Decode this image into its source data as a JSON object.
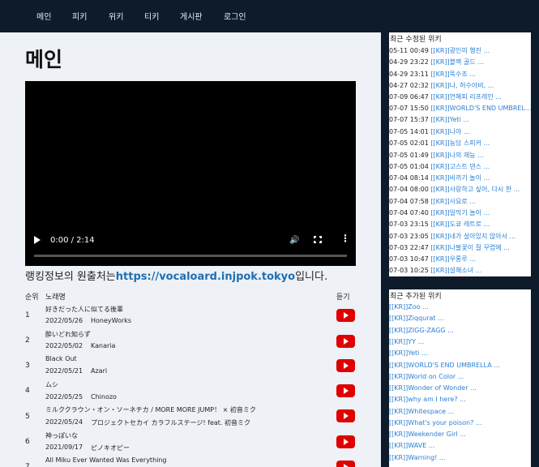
{
  "nav": [
    "메인",
    "피키",
    "위키",
    "티키",
    "게시판",
    "로그인"
  ],
  "main": {
    "title": "메인",
    "video": {
      "time": "0:00 / 2:14",
      "progress": 0
    },
    "source": {
      "prefix": "랭킹정보의 원출처는",
      "link": "https://vocaloard.injpok.tokyo",
      "suffix": "입니다."
    },
    "table": {
      "headers": {
        "rank": "순위",
        "song": "노래명",
        "listen": "듣기"
      },
      "rows": [
        {
          "rank": "1",
          "title": "好きだった人に似てる後輩",
          "date": "2022/05/26",
          "artist": "HoneyWorks"
        },
        {
          "rank": "2",
          "title": "酔いどれ知らず",
          "date": "2022/05/02",
          "artist": "Kanaria"
        },
        {
          "rank": "3",
          "title": "Black Out",
          "date": "2022/05/21",
          "artist": "Azari"
        },
        {
          "rank": "4",
          "title": "ムシ",
          "date": "2022/05/25",
          "artist": "Chinozo"
        },
        {
          "rank": "5",
          "title": "ミルククラウン・オン・ソーネチカ / MORE MORE JUMP！ × 初音ミク",
          "date": "2022/05/24",
          "artist": "プロジェクトセカイ カラフルステージ! feat. 初音ミク"
        },
        {
          "rank": "6",
          "title": "神っぽいな",
          "date": "2021/09/17",
          "artist": "ピノキオピー"
        },
        {
          "rank": "7",
          "title": "All Miku Ever Wanted Was Everything",
          "date": "",
          "artist": ""
        }
      ]
    }
  },
  "sidebar": {
    "recent_edits": {
      "title": "최근 수정된 위키",
      "items": [
        {
          "time": "05-11 00:49",
          "page": "[[KR]]광인의 행진 ..."
        },
        {
          "time": "04-29 23:22",
          "page": "[[KR]]블랙 골드 ..."
        },
        {
          "time": "04-29 23:11",
          "page": "[[KR]]뚝수조 ..."
        },
        {
          "time": "04-27 02:32",
          "page": "[[KR]]나, 허수아비, ..."
        },
        {
          "time": "07-09 06:47",
          "page": "[[KR]]언해피 리프레인 ..."
        },
        {
          "time": "07-07 15:50",
          "page": "[[KR]]WORLD'S END UMBREL..."
        },
        {
          "time": "07-07 15:37",
          "page": "[[KR]]Yeti ..."
        },
        {
          "time": "07-05 14:01",
          "page": "[[KR]]니아 ..."
        },
        {
          "time": "07-05 02:01",
          "page": "[[KR]]농담 스피커 ..."
        },
        {
          "time": "07-05 01:49",
          "page": "[[KR]]나의 재능 ..."
        },
        {
          "time": "07-05 01:04",
          "page": "[[KR]]고스트 댄스 ..."
        },
        {
          "time": "07-04 08:14",
          "page": "[[KR]]비끼기 놀이 ..."
        },
        {
          "time": "07-04 08:00",
          "page": "[[KR]]사랑하고 싶어, 다시 한 ..."
        },
        {
          "time": "07-04 07:58",
          "page": "[[KR]]사요로 ..."
        },
        {
          "time": "07-04 07:40",
          "page": "[[KR]]일막기 놀이 ..."
        },
        {
          "time": "07-03 23:15",
          "page": "[[KR]]도쿄 레트로 ..."
        },
        {
          "time": "07-03 23:05",
          "page": "[[KR]]네가 살아있지 않아서 ..."
        },
        {
          "time": "07-03 22:47",
          "page": "[[KR]]나팔꽃이 질 무렵에 ..."
        },
        {
          "time": "07-03 10:47",
          "page": "[[KR]]우롱루 ..."
        },
        {
          "time": "07-03 10:25",
          "page": "[[KR]]설해소녀 ..."
        }
      ]
    },
    "recent_added": {
      "title": "최근 추가된 위키",
      "items": [
        "[[KR]]Zoo ...",
        "[[KR]]Ziqqurat ...",
        "[[KR]]ZIGG-ZAGG ...",
        "[[KR]]YY ...",
        "[[KR]]Yeti ...",
        "[[KR]]WORLD'S END UMBRELLA ...",
        "[[KR]]World on Color ...",
        "[[KR]]Wonder of Wonder ...",
        "[[KR]]why am I here? ...",
        "[[KR]]Whitespace ...",
        "[[KR]]What's your poison? ...",
        "[[KR]]Weekender Girl ...",
        "[[KR]]WAVE ...",
        "[[KR]]Warning! ..."
      ]
    }
  }
}
